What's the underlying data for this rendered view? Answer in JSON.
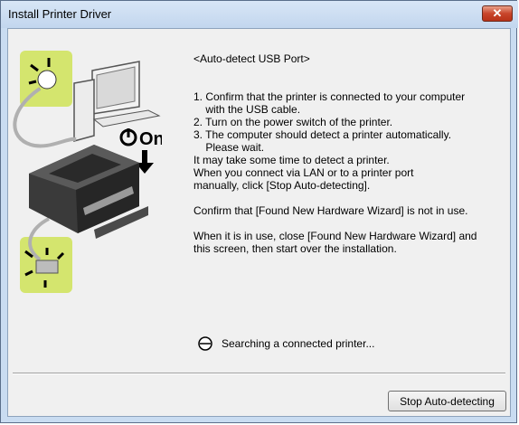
{
  "window": {
    "title": "Install Printer Driver",
    "close_label": "✕"
  },
  "content": {
    "heading": "<Auto-detect USB Port>",
    "steps": [
      "1. Confirm that the printer is connected to your computer",
      "    with the USB cable.",
      "2. Turn on the power switch of the printer.",
      "3. The computer should detect a printer automatically.",
      "    Please wait."
    ],
    "info": [
      "It may take some time to detect a printer.",
      "When you connect via LAN or to a printer port",
      "manually, click [Stop Auto-detecting]."
    ],
    "confirm": "Confirm that [Found New Hardware Wizard] is not in use.",
    "when_in_use": [
      "When it is in use, close [Found New Hardware Wizard] and",
      "this screen, then start over the installation."
    ]
  },
  "illustration": {
    "power_label": "On",
    "icons": [
      "power-icon",
      "computer-icon",
      "printer-icon",
      "usb-plug-icon",
      "down-arrow-icon"
    ]
  },
  "status": {
    "text": "Searching a connected printer...",
    "icon": "busy-icon"
  },
  "buttons": {
    "stop_label": "Stop Auto-detecting"
  },
  "colors": {
    "accent_green": "#d4e56e",
    "close_red": "#c8452b"
  }
}
